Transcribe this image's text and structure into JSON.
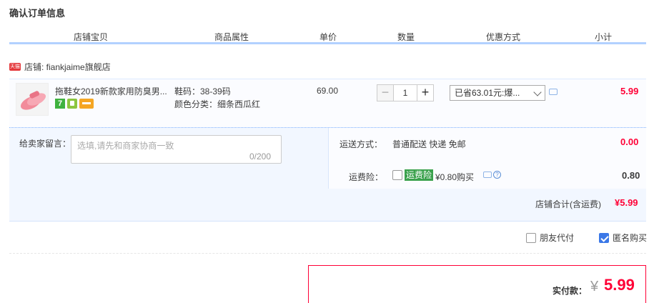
{
  "page_title": "确认订单信息",
  "columns": [
    "店铺宝贝",
    "商品属性",
    "单价",
    "数量",
    "优惠方式",
    "小计"
  ],
  "shop": {
    "icon_text": "天猫",
    "label": "店铺: fiankjaime旗舰店"
  },
  "item": {
    "name": "拖鞋女2019新款家用防臭男...",
    "attr_size": "鞋码：38-39码",
    "attr_color": "颜色分类：细条西瓜红",
    "price": "69.00",
    "qty_minus": "−",
    "qty": "1",
    "qty_plus": "+",
    "promo": "已省63.01元:爆...",
    "subtotal": "5.99",
    "badge_seven": "7"
  },
  "message": {
    "label": "给卖家留言：",
    "placeholder": "选填,请先和商家协商一致",
    "count": "0/200"
  },
  "shipping": {
    "label": "运送方式：",
    "value": "普通配送 快递 免邮",
    "fee": "0.00"
  },
  "insurance": {
    "label": "运费险：",
    "tag": "运费险",
    "text": "¥0.80购买",
    "fee": "0.80",
    "help": "?"
  },
  "shop_total": {
    "label": "店铺合计(含运费)",
    "value": "¥5.99"
  },
  "options": {
    "friend_pay": "朋友代付",
    "anonymous": "匿名购买"
  },
  "payment": {
    "label": "实付款：",
    "currency": "¥",
    "value": "5.99"
  },
  "colors": {
    "accent_red": "#ff0036",
    "header_line": "#b2d1ff",
    "panel_bg": "#f2f7ff"
  }
}
